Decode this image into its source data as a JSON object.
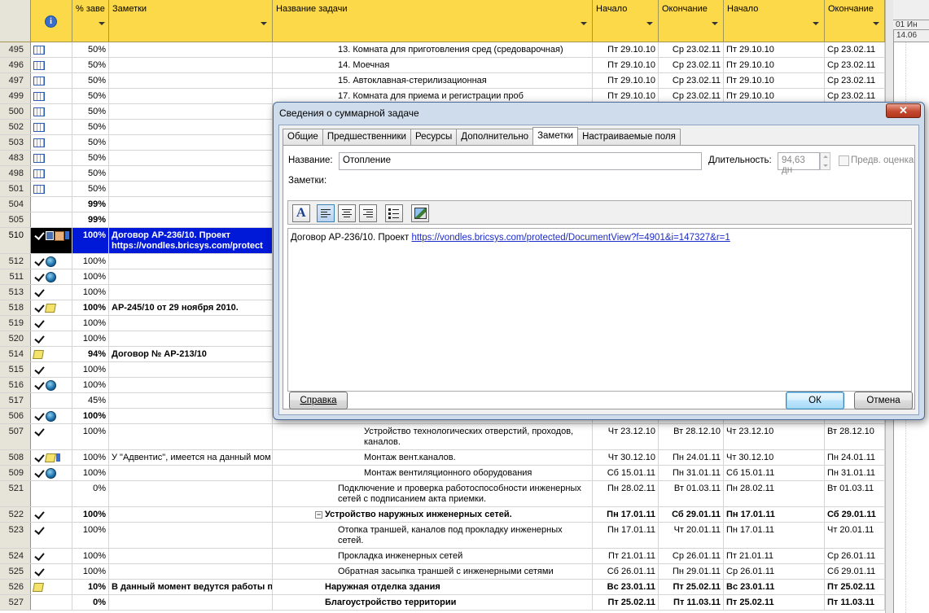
{
  "columns": {
    "row_number": "",
    "indicators_icon": "i",
    "percent": "% заве",
    "notes": "Заметки",
    "task_name": "Название задачи",
    "start": "Начало",
    "finish": "Окончание",
    "start2": "Начало",
    "finish2": "Окончание"
  },
  "gantt_header": {
    "week": "01 Ин",
    "date": "14.06"
  },
  "rows": [
    {
      "id": "495",
      "icons": [
        "cal"
      ],
      "pct": "50%",
      "note": "",
      "name": "13. Комната для приготовления сред (средоварочная)",
      "indent": 80,
      "start": "Пт 29.10.10",
      "finish": "Ср 23.02.11",
      "start2": "Пт 29.10.10",
      "finish2": "Ср 23.02.11",
      "bold": false,
      "lines": 1
    },
    {
      "id": "496",
      "icons": [
        "cal"
      ],
      "pct": "50%",
      "note": "",
      "name": "14. Моечная",
      "indent": 80,
      "start": "Пт 29.10.10",
      "finish": "Ср 23.02.11",
      "start2": "Пт 29.10.10",
      "finish2": "Ср 23.02.11",
      "bold": false,
      "lines": 1
    },
    {
      "id": "497",
      "icons": [
        "cal"
      ],
      "pct": "50%",
      "note": "",
      "name": "15. Автоклавная-стерилизационная",
      "indent": 80,
      "start": "Пт 29.10.10",
      "finish": "Ср 23.02.11",
      "start2": "Пт 29.10.10",
      "finish2": "Ср 23.02.11",
      "bold": false,
      "lines": 1
    },
    {
      "id": "499",
      "icons": [
        "cal"
      ],
      "pct": "50%",
      "note": "",
      "name": "17. Комната для приема и регистрации проб",
      "indent": 80,
      "start": "Пт 29.10.10",
      "finish": "Ср 23.02.11",
      "start2": "Пт 29.10.10",
      "finish2": "Ср 23.02.11",
      "bold": false,
      "lines": 1
    },
    {
      "id": "500",
      "icons": [
        "cal"
      ],
      "pct": "50%",
      "note": "",
      "name": "",
      "indent": 80,
      "start": "",
      "finish": "",
      "start2": "",
      "finish2": "",
      "bold": false,
      "lines": 1
    },
    {
      "id": "502",
      "icons": [
        "cal"
      ],
      "pct": "50%",
      "note": "",
      "name": "",
      "indent": 80,
      "start": "",
      "finish": "",
      "start2": "",
      "finish2": "",
      "bold": false,
      "lines": 1
    },
    {
      "id": "503",
      "icons": [
        "cal"
      ],
      "pct": "50%",
      "note": "",
      "name": "",
      "indent": 80,
      "start": "",
      "finish": "",
      "start2": "",
      "finish2": "",
      "bold": false,
      "lines": 1
    },
    {
      "id": "483",
      "icons": [
        "cal"
      ],
      "pct": "50%",
      "note": "",
      "name": "",
      "indent": 80,
      "start": "",
      "finish": "",
      "start2": "",
      "finish2": "",
      "bold": false,
      "lines": 1
    },
    {
      "id": "498",
      "icons": [
        "cal"
      ],
      "pct": "50%",
      "note": "",
      "name": "",
      "indent": 80,
      "start": "",
      "finish": "",
      "start2": "",
      "finish2": "",
      "bold": false,
      "lines": 1
    },
    {
      "id": "501",
      "icons": [
        "cal"
      ],
      "pct": "50%",
      "note": "",
      "name": "",
      "indent": 80,
      "start": "",
      "finish": "",
      "start2": "",
      "finish2": "",
      "bold": false,
      "lines": 1
    },
    {
      "id": "504",
      "icons": [],
      "pct": "99%",
      "note": "",
      "name": "",
      "indent": 80,
      "start": "",
      "finish": "",
      "start2": "",
      "finish2": "",
      "bold": true,
      "lines": 1
    },
    {
      "id": "505",
      "icons": [],
      "pct": "99%",
      "note": "",
      "name": "",
      "indent": 80,
      "start": "",
      "finish": "",
      "start2": "",
      "finish2": "",
      "bold": true,
      "lines": 1
    },
    {
      "id": "510",
      "icons": [
        "chk",
        "net",
        "pen",
        "small"
      ],
      "pct": "100%",
      "note": "Договор АР-236/10. Проект https://vondles.bricsys.com/protect",
      "name": "",
      "indent": 80,
      "start": "",
      "finish": "",
      "start2": "",
      "finish2": "",
      "bold": true,
      "lines": 2,
      "selected": true
    },
    {
      "id": "512",
      "icons": [
        "chk",
        "glob"
      ],
      "pct": "100%",
      "note": "",
      "name": "",
      "indent": 80,
      "start": "",
      "finish": "",
      "start2": "",
      "finish2": "",
      "bold": false,
      "lines": 1
    },
    {
      "id": "511",
      "icons": [
        "chk",
        "glob"
      ],
      "pct": "100%",
      "note": "",
      "name": "",
      "indent": 80,
      "start": "",
      "finish": "",
      "start2": "",
      "finish2": "",
      "bold": false,
      "lines": 1
    },
    {
      "id": "513",
      "icons": [
        "chk"
      ],
      "pct": "100%",
      "note": "",
      "name": "",
      "indent": 80,
      "start": "",
      "finish": "",
      "start2": "",
      "finish2": "",
      "bold": false,
      "lines": 1
    },
    {
      "id": "518",
      "icons": [
        "chk",
        "note"
      ],
      "pct": "100%",
      "note": "АР-245/10 от 29 ноября 2010.",
      "name": "",
      "indent": 80,
      "start": "",
      "finish": "",
      "start2": "",
      "finish2": "",
      "bold": true,
      "lines": 1
    },
    {
      "id": "519",
      "icons": [
        "chk"
      ],
      "pct": "100%",
      "note": "",
      "name": "",
      "indent": 80,
      "start": "",
      "finish": "",
      "start2": "",
      "finish2": "",
      "bold": false,
      "lines": 1
    },
    {
      "id": "520",
      "icons": [
        "chk"
      ],
      "pct": "100%",
      "note": "",
      "name": "",
      "indent": 80,
      "start": "",
      "finish": "",
      "start2": "",
      "finish2": "",
      "bold": false,
      "lines": 1
    },
    {
      "id": "514",
      "icons": [
        "note"
      ],
      "pct": "94%",
      "note": "Договор № АР-213/10",
      "name": "",
      "indent": 80,
      "start": "",
      "finish": "",
      "start2": "",
      "finish2": "",
      "bold": true,
      "lines": 1
    },
    {
      "id": "515",
      "icons": [
        "chk"
      ],
      "pct": "100%",
      "note": "",
      "name": "",
      "indent": 80,
      "start": "",
      "finish": "",
      "start2": "",
      "finish2": "",
      "bold": false,
      "lines": 1
    },
    {
      "id": "516",
      "icons": [
        "chk",
        "glob"
      ],
      "pct": "100%",
      "note": "",
      "name": "",
      "indent": 80,
      "start": "",
      "finish": "",
      "start2": "",
      "finish2": "",
      "bold": false,
      "lines": 1
    },
    {
      "id": "517",
      "icons": [],
      "pct": "45%",
      "note": "",
      "name": "",
      "indent": 80,
      "start": "",
      "finish": "",
      "start2": "",
      "finish2": "",
      "bold": false,
      "lines": 1
    },
    {
      "id": "506",
      "icons": [
        "chk",
        "glob"
      ],
      "pct": "100%",
      "note": "",
      "name": "",
      "indent": 80,
      "start": "",
      "finish": "",
      "start2": "",
      "finish2": "",
      "bold": true,
      "lines": 1
    },
    {
      "id": "507",
      "icons": [
        "chk"
      ],
      "pct": "100%",
      "note": "",
      "name": "Устройство технологических отверстий, проходов, каналов.",
      "indent": 112,
      "start": "Чт 23.12.10",
      "finish": "Вт 28.12.10",
      "start2": "Чт 23.12.10",
      "finish2": "Вт 28.12.10",
      "bold": false,
      "lines": 2
    },
    {
      "id": "508",
      "icons": [
        "chk",
        "note",
        "small"
      ],
      "pct": "100%",
      "note": "У \"Адвентис\", имеется на данный мом",
      "name": "Монтаж вент.каналов.",
      "indent": 112,
      "start": "Чт 30.12.10",
      "finish": "Пн 24.01.11",
      "start2": "Чт 30.12.10",
      "finish2": "Пн 24.01.11",
      "bold": false,
      "lines": 1
    },
    {
      "id": "509",
      "icons": [
        "chk",
        "glob"
      ],
      "pct": "100%",
      "note": "",
      "name": "Монтаж вентиляционного оборудования",
      "indent": 112,
      "start": "Сб 15.01.11",
      "finish": "Пн 31.01.11",
      "start2": "Сб 15.01.11",
      "finish2": "Пн 31.01.11",
      "bold": false,
      "lines": 1
    },
    {
      "id": "521",
      "icons": [],
      "pct": "0%",
      "note": "",
      "name": "Подключение и проверка работоспособности инженерных сетей с подписанием акта приемки.",
      "indent": 80,
      "start": "Пн 28.02.11",
      "finish": "Вт 01.03.11",
      "start2": "Пн 28.02.11",
      "finish2": "Вт 01.03.11",
      "bold": false,
      "lines": 2
    },
    {
      "id": "522",
      "icons": [
        "chk"
      ],
      "pct": "100%",
      "note": "",
      "name": "Устройство наружных инженерных сетей.",
      "indent": 52,
      "start": "Пн 17.01.11",
      "finish": "Сб 29.01.11",
      "start2": "Пн 17.01.11",
      "finish2": "Сб 29.01.11",
      "bold": true,
      "lines": 1,
      "collapse": true
    },
    {
      "id": "523",
      "icons": [
        "chk"
      ],
      "pct": "100%",
      "note": "",
      "name": "Отопка траншей, каналов под прокладку инженерных сетей.",
      "indent": 80,
      "start": "Пн 17.01.11",
      "finish": "Чт 20.01.11",
      "start2": "Пн 17.01.11",
      "finish2": "Чт 20.01.11",
      "bold": false,
      "lines": 2
    },
    {
      "id": "524",
      "icons": [
        "chk"
      ],
      "pct": "100%",
      "note": "",
      "name": "Прокладка инженерных сетей",
      "indent": 80,
      "start": "Пт 21.01.11",
      "finish": "Ср 26.01.11",
      "start2": "Пт 21.01.11",
      "finish2": "Ср 26.01.11",
      "bold": false,
      "lines": 1
    },
    {
      "id": "525",
      "icons": [
        "chk"
      ],
      "pct": "100%",
      "note": "",
      "name": "Обратная засыпка траншей с инженерными сетями",
      "indent": 80,
      "start": "Сб 26.01.11",
      "finish": "Пн 29.01.11",
      "start2": "Ср 26.01.11",
      "finish2": "Сб 29.01.11",
      "bold": false,
      "lines": 1
    },
    {
      "id": "526",
      "icons": [
        "note"
      ],
      "pct": "10%",
      "note": "В данный момент ведутся работы по",
      "name": "Наружная отделка здания",
      "indent": 64,
      "start": "Вс 23.01.11",
      "finish": "Пт 25.02.11",
      "start2": "Вс 23.01.11",
      "finish2": "Пт 25.02.11",
      "bold": true,
      "lines": 1
    },
    {
      "id": "527",
      "icons": [],
      "pct": "0%",
      "note": "",
      "name": "Благоустройство территории",
      "indent": 64,
      "start": "Пт 25.02.11",
      "finish": "Пт 11.03.11",
      "start2": "Пт 25.02.11",
      "finish2": "Пт 11.03.11",
      "bold": true,
      "lines": 1
    }
  ],
  "dialog": {
    "title": "Сведения о суммарной задаче",
    "close": "✕",
    "tabs": [
      "Общие",
      "Предшественники",
      "Ресурсы",
      "Дополнительно",
      "Заметки",
      "Настраиваемые поля"
    ],
    "active_tab": "Заметки",
    "name_label": "Название:",
    "name_value": "Отопление",
    "duration_label": "Длительность:",
    "duration_value": "94,63 дн",
    "estimate_label": "Предв. оценка",
    "notes_label": "Заметки:",
    "note_prefix": "Договор АР-236/10. Проект ",
    "note_link": "https://vondles.bricsys.com/protected/DocumentView?f=4901&i=147327&r=1",
    "help_button": "Справка",
    "ok_button": "ОК",
    "cancel_button": "Отмена"
  }
}
